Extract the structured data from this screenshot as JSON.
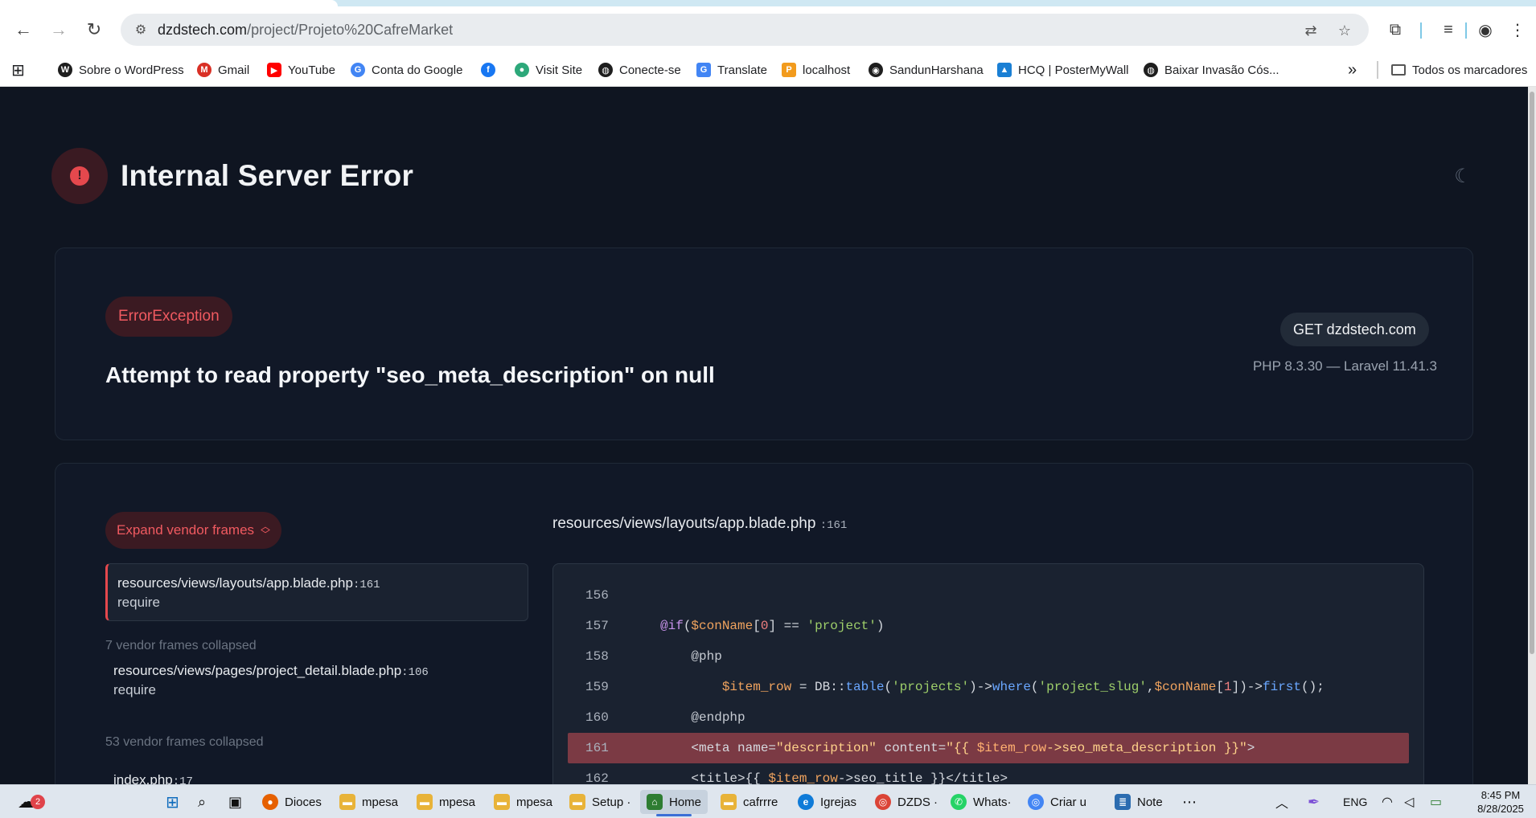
{
  "browser": {
    "url_host": "dzdstech.com",
    "url_path": "/project/Projeto%20CafreMarket"
  },
  "bookmarks": [
    {
      "label": "Sobre o WordPress",
      "color": "#1e1e1e"
    },
    {
      "label": "Gmail",
      "color": "#d93025"
    },
    {
      "label": "YouTube",
      "color": "#ff0000"
    },
    {
      "label": "Conta do Google",
      "color": "#4285f4"
    },
    {
      "label": "",
      "color": "#1877f2"
    },
    {
      "label": "Visit Site",
      "color": "#2da87a"
    },
    {
      "label": "Conecte-se",
      "color": "#1e1e1e"
    },
    {
      "label": "Translate",
      "color": "#4285f4"
    },
    {
      "label": "localhost",
      "color": "#f29b1d"
    },
    {
      "label": "SandunHarshana",
      "color": "#1e1e1e"
    },
    {
      "label": "HCQ | PosterMyWall",
      "color": "#1a7fd4"
    },
    {
      "label": "Baixar Invasão Cós...",
      "color": "#1e1e1e"
    }
  ],
  "bookmarks_more": "»",
  "bookmarks_all": "Todos os marcadores",
  "error": {
    "title": "Internal Server Error",
    "exception_type": "ErrorException",
    "message": "Attempt to read property \"seo_meta_description\" on null",
    "request": "GET dzdstech.com",
    "versions": "PHP 8.3.30 — Laravel 11.41.3"
  },
  "frames": {
    "expand_label": "Expand vendor frames",
    "active": {
      "path": "resources/views/layouts/app.blade.php",
      "line": ":161",
      "sub": "require"
    },
    "collapsed_1": "7 vendor frames collapsed",
    "second": {
      "path": "resources/views/pages/project_detail.blade.php",
      "line": ":106",
      "sub": "require"
    },
    "collapsed_2": "53 vendor frames collapsed",
    "third": {
      "path": "index.php",
      "line": ":17"
    }
  },
  "source": {
    "file": "resources/views/layouts/app.blade.php",
    "line": ":161",
    "line_numbers": [
      "156",
      "157",
      "158",
      "159",
      "160",
      "161",
      "162"
    ]
  },
  "taskbar": {
    "badge": "2",
    "items": [
      {
        "label": "Dioces",
        "color": "#e66000"
      },
      {
        "label": "mpesa",
        "color": "#e8b339"
      },
      {
        "label": "mpesa",
        "color": "#e8b339"
      },
      {
        "label": "mpesa",
        "color": "#e8b339"
      },
      {
        "label": "Setup ·",
        "color": "#e8b339"
      },
      {
        "label": "Home",
        "color": "#2e7d32"
      },
      {
        "label": "cafrrre",
        "color": "#e8b339"
      },
      {
        "label": "Igrejas",
        "color": "#0f7bd8"
      },
      {
        "label": "DZDS ·",
        "color": "#db4437"
      },
      {
        "label": "Whats·",
        "color": "#25d366"
      },
      {
        "label": "Criar u",
        "color": "#4285f4"
      },
      {
        "label": "Note",
        "color": "#2b6cb0"
      }
    ],
    "lang": "ENG",
    "time": "8:45 PM",
    "date": "8/28/2025"
  }
}
